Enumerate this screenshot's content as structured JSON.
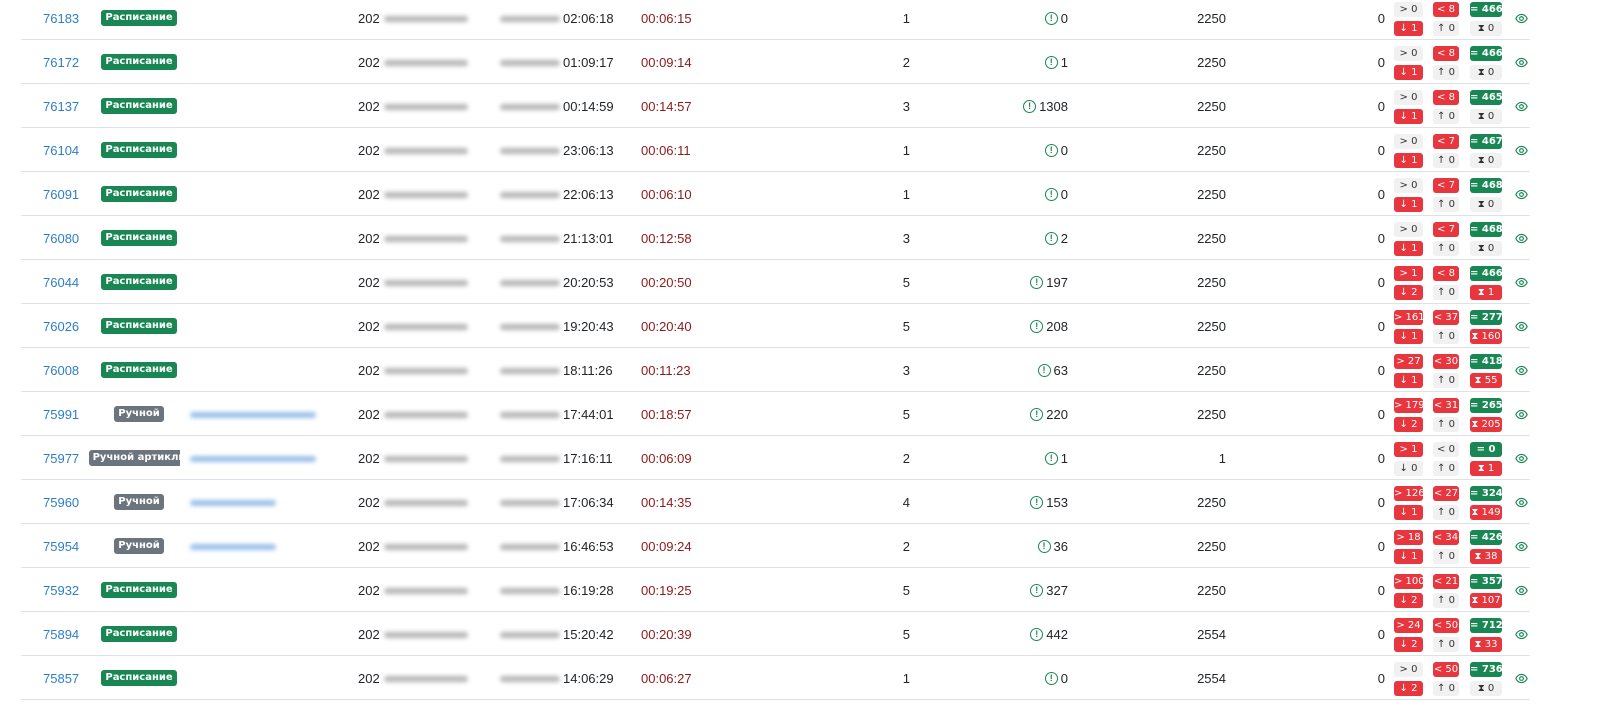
{
  "colors": {
    "link": "#2f7ec9",
    "schedule_badge": "#198754",
    "manual_badge": "#6c757d",
    "red": "#e8363e",
    "green": "#198754",
    "duration": "#8b1a1a"
  },
  "rows": [
    {
      "id": "76183",
      "type": "Расписание",
      "type_kind": "sched",
      "user": "",
      "start_prefix": "202",
      "end_time": "02:06:18",
      "duration": "00:06:15",
      "runs": "1",
      "errors": "0",
      "limit": "2250",
      "zero": "0",
      "gt": "> 0",
      "lt": "< 8",
      "eq": "= 466",
      "dn": "↓ 1",
      "up": "↑ 0",
      "hg": "⧗ 0",
      "gt_kind": "gray",
      "dn_kind": "red",
      "hg_kind": "gray"
    },
    {
      "id": "76172",
      "type": "Расписание",
      "type_kind": "sched",
      "user": "",
      "start_prefix": "202",
      "end_time": "01:09:17",
      "duration": "00:09:14",
      "runs": "2",
      "errors": "1",
      "limit": "2250",
      "zero": "0",
      "gt": "> 0",
      "lt": "< 8",
      "eq": "= 466",
      "dn": "↓ 1",
      "up": "↑ 0",
      "hg": "⧗ 0",
      "gt_kind": "gray",
      "dn_kind": "red",
      "hg_kind": "gray"
    },
    {
      "id": "76137",
      "type": "Расписание",
      "type_kind": "sched",
      "user": "",
      "start_prefix": "202",
      "end_time": "00:14:59",
      "duration": "00:14:57",
      "runs": "3",
      "errors": "1308",
      "limit": "2250",
      "zero": "0",
      "gt": "> 0",
      "lt": "< 8",
      "eq": "= 465",
      "dn": "↓ 1",
      "up": "↑ 0",
      "hg": "⧗ 0",
      "gt_kind": "gray",
      "dn_kind": "red",
      "hg_kind": "gray"
    },
    {
      "id": "76104",
      "type": "Расписание",
      "type_kind": "sched",
      "user": "",
      "start_prefix": "202",
      "end_time": "23:06:13",
      "duration": "00:06:11",
      "runs": "1",
      "errors": "0",
      "limit": "2250",
      "zero": "0",
      "gt": "> 0",
      "lt": "< 7",
      "eq": "= 467",
      "dn": "↓ 1",
      "up": "↑ 0",
      "hg": "⧗ 0",
      "gt_kind": "gray",
      "dn_kind": "red",
      "hg_kind": "gray"
    },
    {
      "id": "76091",
      "type": "Расписание",
      "type_kind": "sched",
      "user": "",
      "start_prefix": "202",
      "end_time": "22:06:13",
      "duration": "00:06:10",
      "runs": "1",
      "errors": "0",
      "limit": "2250",
      "zero": "0",
      "gt": "> 0",
      "lt": "< 7",
      "eq": "= 468",
      "dn": "↓ 1",
      "up": "↑ 0",
      "hg": "⧗ 0",
      "gt_kind": "gray",
      "dn_kind": "red",
      "hg_kind": "gray"
    },
    {
      "id": "76080",
      "type": "Расписание",
      "type_kind": "sched",
      "user": "",
      "start_prefix": "202",
      "end_time": "21:13:01",
      "duration": "00:12:58",
      "runs": "3",
      "errors": "2",
      "limit": "2250",
      "zero": "0",
      "gt": "> 0",
      "lt": "< 7",
      "eq": "= 468",
      "dn": "↓ 1",
      "up": "↑ 0",
      "hg": "⧗ 0",
      "gt_kind": "gray",
      "dn_kind": "red",
      "hg_kind": "gray"
    },
    {
      "id": "76044",
      "type": "Расписание",
      "type_kind": "sched",
      "user": "",
      "start_prefix": "202",
      "end_time": "20:20:53",
      "duration": "00:20:50",
      "runs": "5",
      "errors": "197",
      "limit": "2250",
      "zero": "0",
      "gt": "> 1",
      "lt": "< 8",
      "eq": "= 466",
      "dn": "↓ 2",
      "up": "↑ 0",
      "hg": "⧗ 1",
      "gt_kind": "red",
      "dn_kind": "red",
      "hg_kind": "red"
    },
    {
      "id": "76026",
      "type": "Расписание",
      "type_kind": "sched",
      "user": "",
      "start_prefix": "202",
      "end_time": "19:20:43",
      "duration": "00:20:40",
      "runs": "5",
      "errors": "208",
      "limit": "2250",
      "zero": "0",
      "gt": "> 161",
      "lt": "< 37",
      "eq": "= 277",
      "dn": "↓ 1",
      "up": "↑ 0",
      "hg": "⧗ 160",
      "gt_kind": "red",
      "dn_kind": "red",
      "hg_kind": "red"
    },
    {
      "id": "76008",
      "type": "Расписание",
      "type_kind": "sched",
      "user": "",
      "start_prefix": "202",
      "end_time": "18:11:26",
      "duration": "00:11:23",
      "runs": "3",
      "errors": "63",
      "limit": "2250",
      "zero": "0",
      "gt": "> 27",
      "lt": "< 30",
      "eq": "= 418",
      "dn": "↓ 1",
      "up": "↑ 0",
      "hg": "⧗ 55",
      "gt_kind": "red",
      "dn_kind": "red",
      "hg_kind": "red"
    },
    {
      "id": "75991",
      "type": "Ручной",
      "type_kind": "manual",
      "user": "blurred",
      "start_prefix": "202",
      "end_time": "17:44:01",
      "duration": "00:18:57",
      "runs": "5",
      "errors": "220",
      "limit": "2250",
      "zero": "0",
      "gt": "> 179",
      "lt": "< 31",
      "eq": "= 265",
      "dn": "↓ 2",
      "up": "↑ 0",
      "hg": "⧗ 205",
      "gt_kind": "red",
      "dn_kind": "red",
      "hg_kind": "red"
    },
    {
      "id": "75977",
      "type": "Ручной артикли",
      "type_kind": "manual",
      "user": "blurred",
      "start_prefix": "202",
      "end_time": "17:16:11",
      "duration": "00:06:09",
      "runs": "2",
      "errors": "1",
      "limit": "1",
      "zero": "0",
      "gt": "> 1",
      "lt": "< 0",
      "eq": "= 0",
      "dn": "↓ 0",
      "up": "↑ 0",
      "hg": "⧗ 1",
      "gt_kind": "red",
      "dn_kind": "gray",
      "hg_kind": "red",
      "lt_kind": "gray"
    },
    {
      "id": "75960",
      "type": "Ручной",
      "type_kind": "manual",
      "user": "blurred",
      "start_prefix": "202",
      "end_time": "17:06:34",
      "duration": "00:14:35",
      "runs": "4",
      "errors": "153",
      "limit": "2250",
      "zero": "0",
      "gt": "> 126",
      "lt": "< 27",
      "eq": "= 324",
      "dn": "↓ 1",
      "up": "↑ 0",
      "hg": "⧗ 149",
      "gt_kind": "red",
      "dn_kind": "red",
      "hg_kind": "red"
    },
    {
      "id": "75954",
      "type": "Ручной",
      "type_kind": "manual",
      "user": "blurred",
      "start_prefix": "202",
      "end_time": "16:46:53",
      "duration": "00:09:24",
      "runs": "2",
      "errors": "36",
      "limit": "2250",
      "zero": "0",
      "gt": "> 18",
      "lt": "< 34",
      "eq": "= 426",
      "dn": "↓ 1",
      "up": "↑ 0",
      "hg": "⧗ 38",
      "gt_kind": "red",
      "dn_kind": "red",
      "hg_kind": "red"
    },
    {
      "id": "75932",
      "type": "Расписание",
      "type_kind": "sched",
      "user": "",
      "start_prefix": "202",
      "end_time": "16:19:28",
      "duration": "00:19:25",
      "runs": "5",
      "errors": "327",
      "limit": "2250",
      "zero": "0",
      "gt": "> 100",
      "lt": "< 21",
      "eq": "= 357",
      "dn": "↓ 2",
      "up": "↑ 0",
      "hg": "⧗ 107",
      "gt_kind": "red",
      "dn_kind": "red",
      "hg_kind": "red"
    },
    {
      "id": "75894",
      "type": "Расписание",
      "type_kind": "sched",
      "user": "",
      "start_prefix": "202",
      "end_time": "15:20:42",
      "duration": "00:20:39",
      "runs": "5",
      "errors": "442",
      "limit": "2554",
      "zero": "0",
      "gt": "> 24",
      "lt": "< 50",
      "eq": "= 712",
      "dn": "↓ 2",
      "up": "↑ 0",
      "hg": "⧗ 33",
      "gt_kind": "red",
      "dn_kind": "red",
      "hg_kind": "red"
    },
    {
      "id": "75857",
      "type": "Расписание",
      "type_kind": "sched",
      "user": "",
      "start_prefix": "202",
      "end_time": "14:06:29",
      "duration": "00:06:27",
      "runs": "1",
      "errors": "0",
      "limit": "2554",
      "zero": "0",
      "gt": "> 0",
      "lt": "< 50",
      "eq": "= 736",
      "dn": "↓ 2",
      "up": "↑ 0",
      "hg": "⧗ 0",
      "gt_kind": "gray",
      "dn_kind": "red",
      "hg_kind": "gray"
    }
  ]
}
